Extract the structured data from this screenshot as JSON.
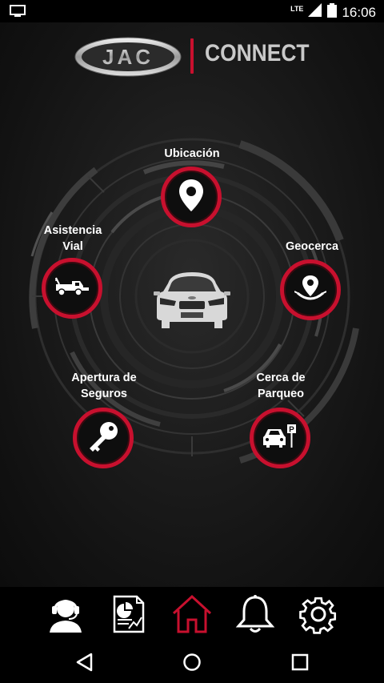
{
  "status_bar": {
    "network": "LTE",
    "time": "16:06"
  },
  "header": {
    "logo_text": "JAC",
    "title": "CONNECT"
  },
  "features": [
    {
      "id": "ubicacion",
      "label": "Ubicación",
      "icon": "location-pin-icon"
    },
    {
      "id": "asistencia",
      "label": "Asistencia\nVial",
      "icon": "tow-truck-icon"
    },
    {
      "id": "geocerca",
      "label": "Geocerca",
      "icon": "geofence-pin-icon"
    },
    {
      "id": "apertura",
      "label": "Apertura de\nSeguros",
      "icon": "key-icon"
    },
    {
      "id": "cerca",
      "label": "Cerca de\nParqueo",
      "icon": "car-parking-icon"
    }
  ],
  "center": {
    "icon": "car-front-icon"
  },
  "bottom_nav": [
    {
      "id": "support",
      "icon": "support-agent-icon",
      "active": false
    },
    {
      "id": "reports",
      "icon": "report-chart-icon",
      "active": false
    },
    {
      "id": "home",
      "icon": "home-icon",
      "active": true
    },
    {
      "id": "notifications",
      "icon": "bell-icon",
      "active": false
    },
    {
      "id": "settings",
      "icon": "gear-icon",
      "active": false
    }
  ],
  "colors": {
    "accent": "#c8102e",
    "background": "#1b1b1b",
    "icon": "#ffffff"
  }
}
